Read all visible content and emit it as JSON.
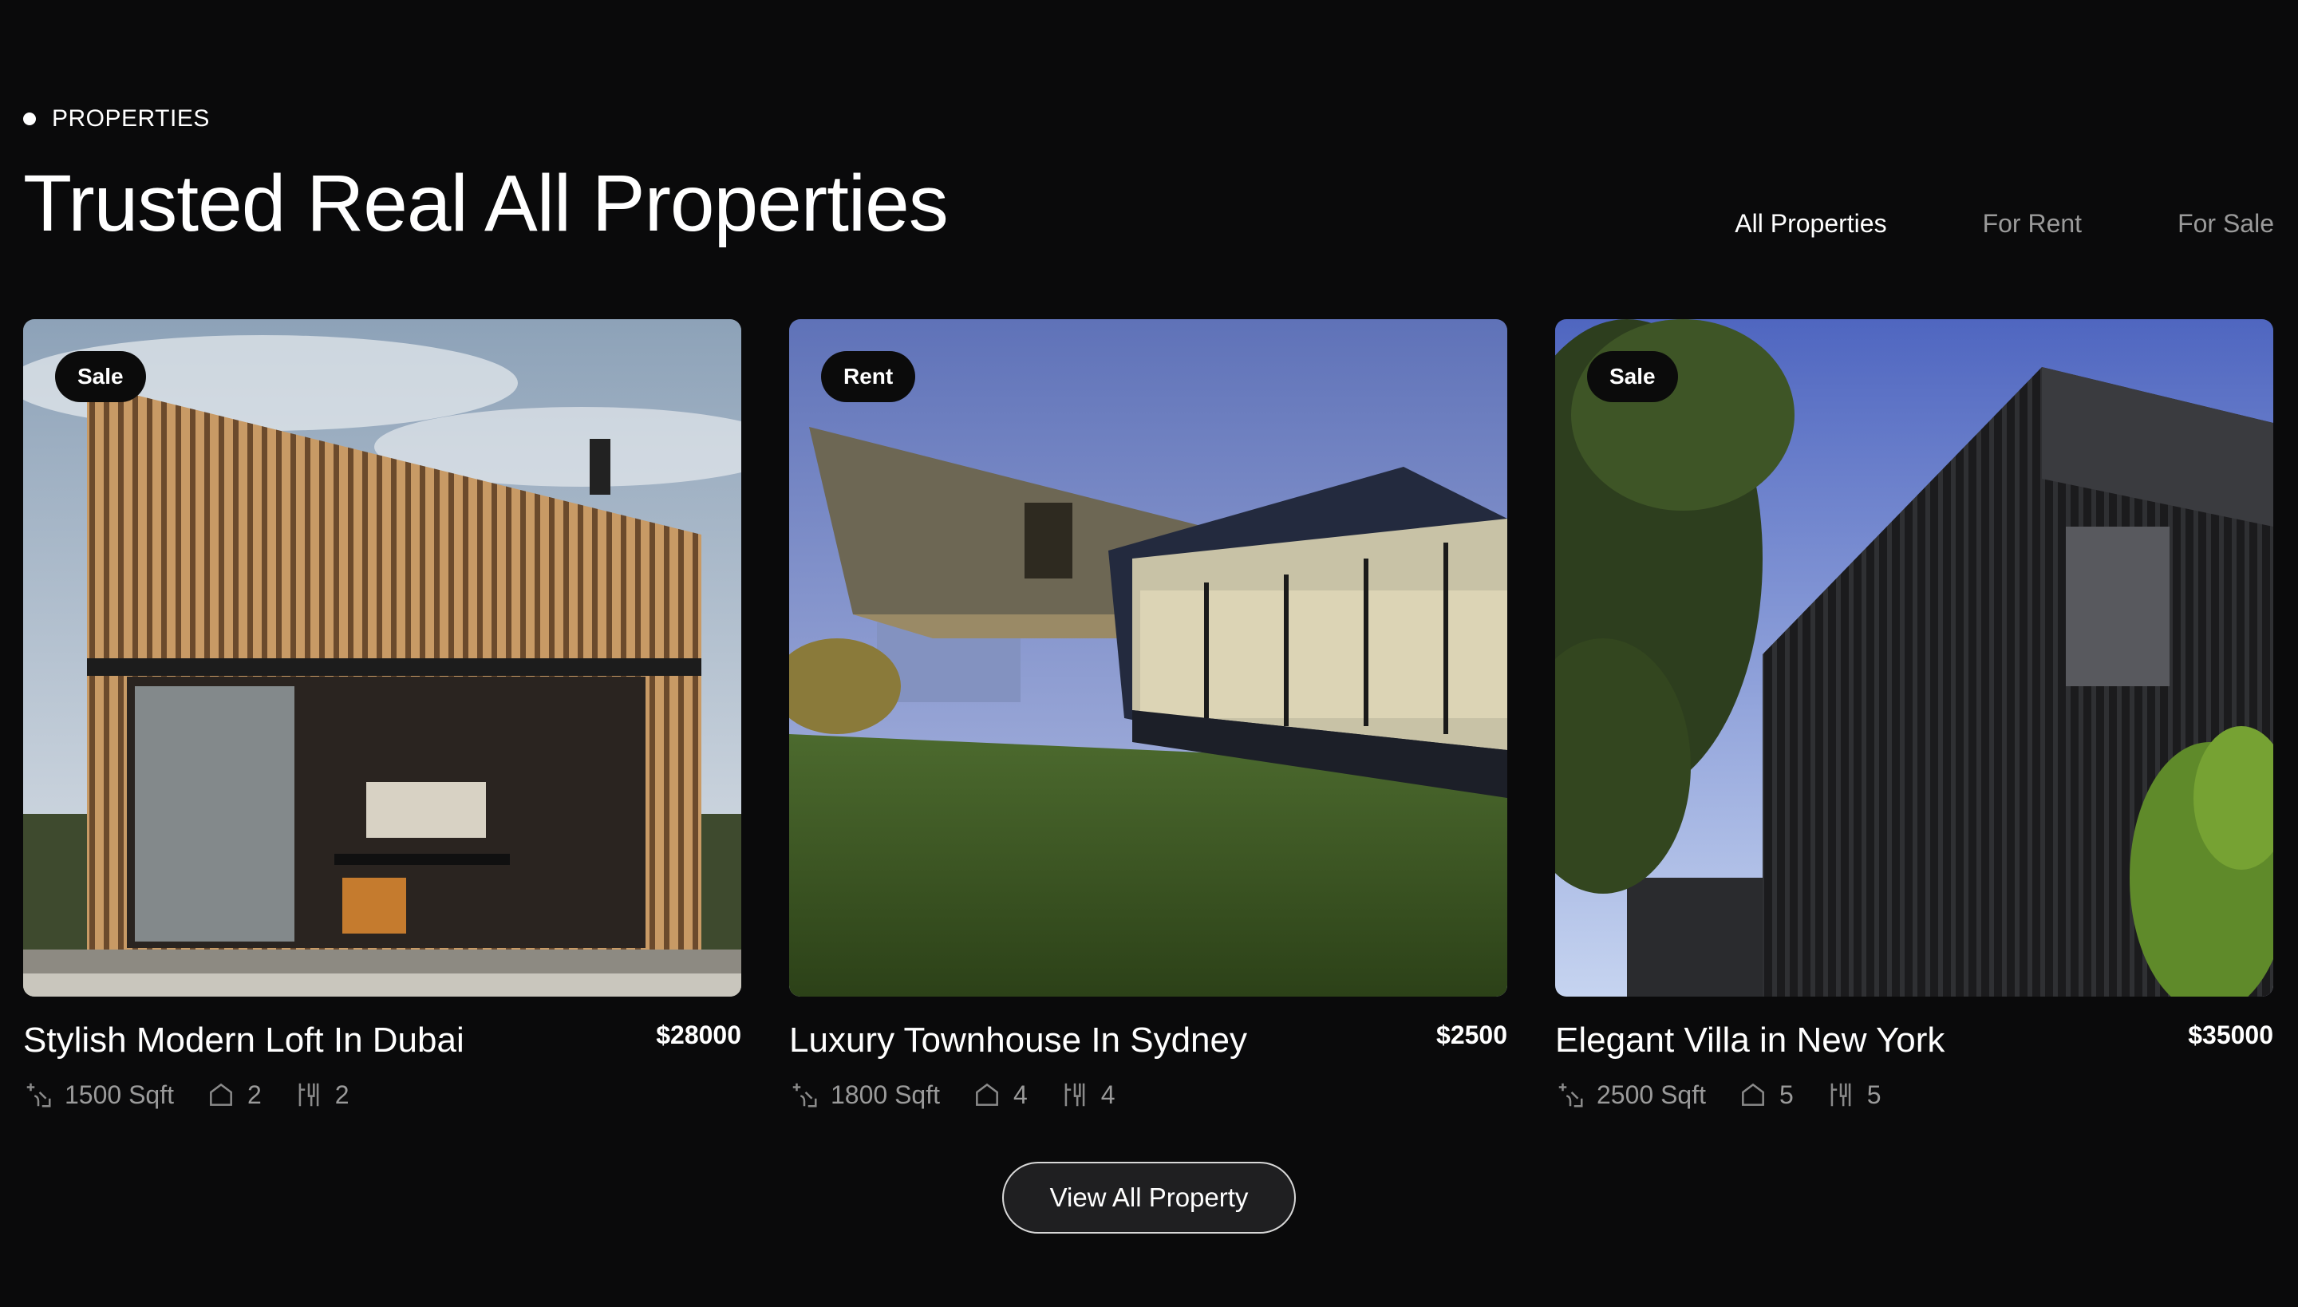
{
  "section": {
    "eyebrow": "PROPERTIES",
    "heading": "Trusted Real All Properties"
  },
  "filters": [
    {
      "label": "All Properties",
      "active": true
    },
    {
      "label": "For Rent",
      "active": false
    },
    {
      "label": "For Sale",
      "active": false
    }
  ],
  "cards": [
    {
      "badge": "Sale",
      "title": "Stylish Modern Loft In Dubai",
      "price": "$28000",
      "area": "1500 Sqft",
      "beds": "2",
      "baths": "2"
    },
    {
      "badge": "Rent",
      "title": "Luxury Townhouse In Sydney",
      "price": "$2500",
      "area": "1800 Sqft",
      "beds": "4",
      "baths": "4"
    },
    {
      "badge": "Sale",
      "title": "Elegant Villa in New York",
      "price": "$35000",
      "area": "2500 Sqft",
      "beds": "5",
      "baths": "5"
    }
  ],
  "cta": {
    "label": "View All Property"
  },
  "icons": {
    "area": "area-icon",
    "beds": "bed-icon",
    "baths": "bath-icon"
  }
}
